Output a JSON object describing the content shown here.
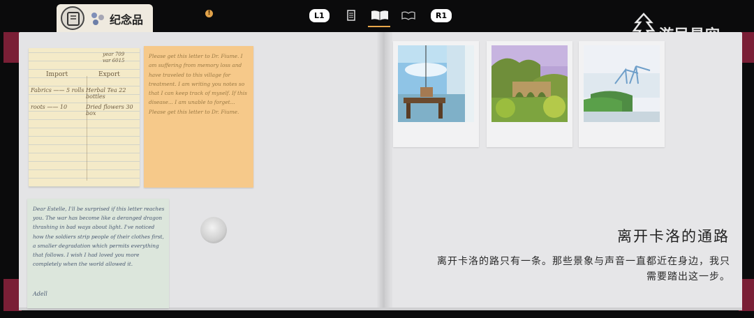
{
  "nav": {
    "tab_label": "纪念品",
    "alert_badge": "!",
    "left_button": "L1",
    "right_button": "R1",
    "icons": [
      "memento-book-icon",
      "notes-icon",
      "open-book-icon",
      "map-book-icon"
    ],
    "accent_color": "#e9a74a"
  },
  "watermark": {
    "text": "游民星空"
  },
  "notes": {
    "ledger": {
      "date": "year 709\nvar 6015",
      "import_header": "Import",
      "export_header": "Export",
      "import_rows": [
        "Fabrics —— 5 rolls",
        "roots —— 10"
      ],
      "export_rows": [
        "Herbal Tea 22 bottles",
        "Dried flowers 30 box"
      ]
    },
    "orange_letter": {
      "text": "Please get this letter to Dr. Fiume. I am suffering from memory loss and have traveled to this village for treatment. I am writing you notes so that I can keep track of myself. If this disease... I am unable to forget... Please get this letter to Dr. Fiume."
    },
    "blue_letter": {
      "text": "Dear Estelle, I'll be surprised if this letter reaches you. The war has become like a deranged dragon thrashing in bad ways about light. I've noticed how the soldiers strip people of their clothes first, a smaller degradation which permits everything that follows. I wish I had loved you more completely when the world allowed it.",
      "signature": "Adell"
    }
  },
  "photos": [
    {
      "scene": "window-desk"
    },
    {
      "scene": "aqueduct-bridge"
    },
    {
      "scene": "harbor-cranes"
    }
  ],
  "entry": {
    "title": "离开卡洛的通路",
    "description_line1": "离开卡洛的路只有一条。那些景象与声音一直都近在身边，我只",
    "description_line2": "需要踏出这一步。"
  }
}
